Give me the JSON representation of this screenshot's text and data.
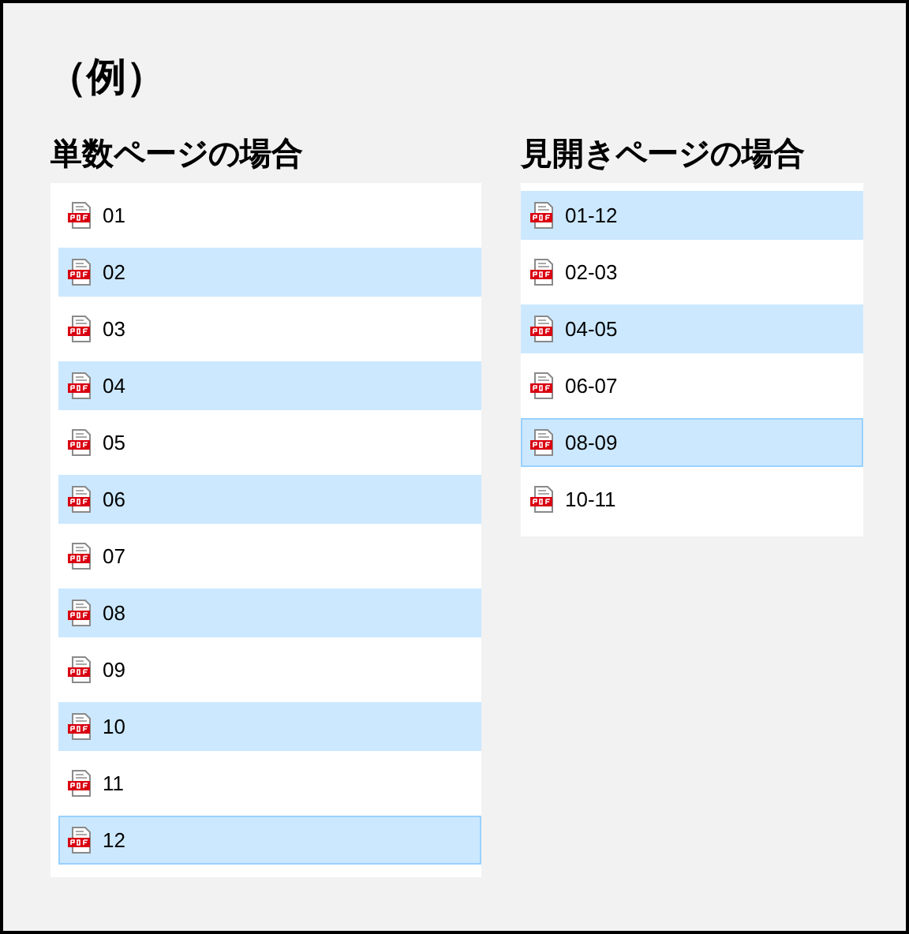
{
  "title": "（例）",
  "sections": [
    {
      "heading": "単数ページの場合",
      "items": [
        {
          "label": "01",
          "selected": false,
          "focused": false
        },
        {
          "label": "02",
          "selected": true,
          "focused": false
        },
        {
          "label": "03",
          "selected": false,
          "focused": false
        },
        {
          "label": "04",
          "selected": true,
          "focused": false
        },
        {
          "label": "05",
          "selected": false,
          "focused": false
        },
        {
          "label": "06",
          "selected": true,
          "focused": false
        },
        {
          "label": "07",
          "selected": false,
          "focused": false
        },
        {
          "label": "08",
          "selected": true,
          "focused": false
        },
        {
          "label": "09",
          "selected": false,
          "focused": false
        },
        {
          "label": "10",
          "selected": true,
          "focused": false
        },
        {
          "label": "11",
          "selected": false,
          "focused": false
        },
        {
          "label": "12",
          "selected": true,
          "focused": true
        }
      ]
    },
    {
      "heading": "見開きページの場合",
      "items": [
        {
          "label": "01-12",
          "selected": true,
          "focused": false
        },
        {
          "label": "02-03",
          "selected": false,
          "focused": false
        },
        {
          "label": "04-05",
          "selected": true,
          "focused": false
        },
        {
          "label": "06-07",
          "selected": false,
          "focused": false
        },
        {
          "label": "08-09",
          "selected": true,
          "focused": true
        },
        {
          "label": "10-11",
          "selected": false,
          "focused": false
        }
      ]
    }
  ]
}
